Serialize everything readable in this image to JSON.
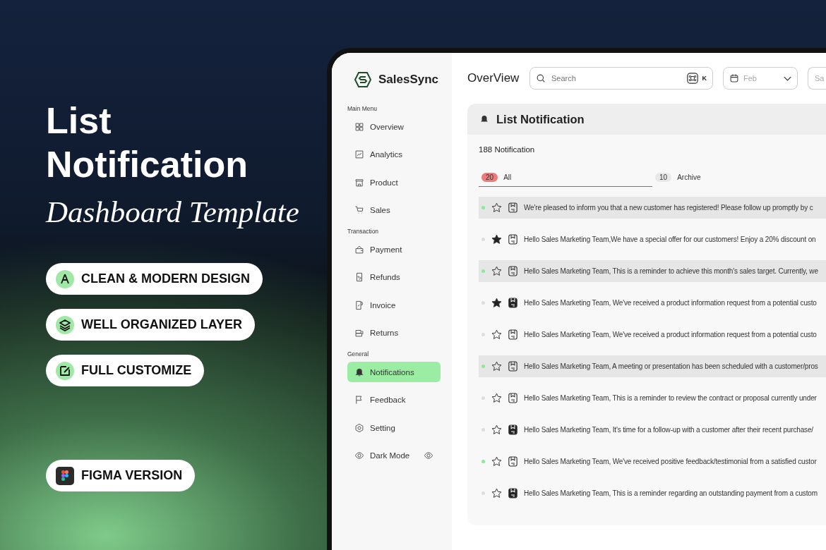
{
  "promo": {
    "title": "List Notification",
    "subtitle": "Dashboard Template",
    "features": [
      "CLEAN & MODERN DESIGN",
      "WELL ORGANIZED LAYER",
      "FULL CUSTOMIZE"
    ],
    "figma_badge": "FIGMA VERSION"
  },
  "app": {
    "brand": "SalesSync",
    "sidebar": [
      {
        "heading": "Main Menu",
        "items": [
          {
            "label": "Overview",
            "selected": false
          },
          {
            "label": "Analytics",
            "selected": false
          },
          {
            "label": "Product",
            "selected": false
          },
          {
            "label": "Sales",
            "selected": false
          }
        ]
      },
      {
        "heading": "Transaction",
        "items": [
          {
            "label": "Payment",
            "selected": false
          },
          {
            "label": "Refunds",
            "selected": false
          },
          {
            "label": "Invoice",
            "selected": false
          },
          {
            "label": "Returns",
            "selected": false
          }
        ]
      },
      {
        "heading": "General",
        "items": [
          {
            "label": "Notifications",
            "selected": true
          },
          {
            "label": "Feedback",
            "selected": false
          },
          {
            "label": "Setting",
            "selected": false
          },
          {
            "label": "Dark Mode",
            "selected": false,
            "kind": "toggle"
          }
        ]
      }
    ],
    "page_title": "OverView",
    "search": {
      "placeholder": "Search",
      "shortcut": "K"
    },
    "month_select": {
      "placeholder": "Feb"
    },
    "cut_field": {
      "placeholder": "Sa"
    },
    "panel": {
      "title": "List Notification",
      "count": "188 Notification",
      "tabs": [
        {
          "label": "All",
          "badge": "20",
          "selected": true
        },
        {
          "label": "Archive",
          "badge": "10",
          "selected": false
        }
      ],
      "rows": [
        {
          "text": "We're pleased to inform you that a new customer has registered! Please follow up promptly  by c",
          "unread": true,
          "starred": false,
          "saved": false,
          "selected": true
        },
        {
          "text": "Hello Sales Marketing Team,We have a special offer for our customers! Enjoy a 20% discount on",
          "unread": false,
          "starred": true,
          "saved": false,
          "selected": false
        },
        {
          "text": "Hello Sales Marketing Team, This is a reminder to achieve this month's sales target. Currently, we",
          "unread": true,
          "starred": false,
          "saved": false,
          "selected": true
        },
        {
          "text": "Hello Sales Marketing Team, We've received a product information request from a potential custo",
          "unread": false,
          "starred": true,
          "saved": true,
          "selected": false
        },
        {
          "text": "Hello Sales Marketing Team, We've received a product information request from a potential custo",
          "unread": false,
          "starred": false,
          "saved": false,
          "selected": false
        },
        {
          "text": "Hello Sales Marketing Team, A meeting or presentation has been scheduled with a customer/pros",
          "unread": true,
          "starred": false,
          "saved": false,
          "selected": true
        },
        {
          "text": "Hello Sales Marketing Team, This is a reminder to review the contract or proposal currently under",
          "unread": false,
          "starred": false,
          "saved": false,
          "selected": false
        },
        {
          "text": "Hello Sales Marketing Team, It's time for a follow-up with a customer after their recent purchase/",
          "unread": false,
          "starred": false,
          "saved": true,
          "selected": false
        },
        {
          "text": "Hello Sales Marketing Team, We've received positive feedback/testimonial from a satisfied custor",
          "unread": true,
          "starred": false,
          "saved": false,
          "selected": false
        },
        {
          "text": "Hello Sales Marketing Team, This is a reminder regarding an outstanding payment from a custom",
          "unread": false,
          "starred": false,
          "saved": true,
          "selected": false
        }
      ]
    }
  }
}
